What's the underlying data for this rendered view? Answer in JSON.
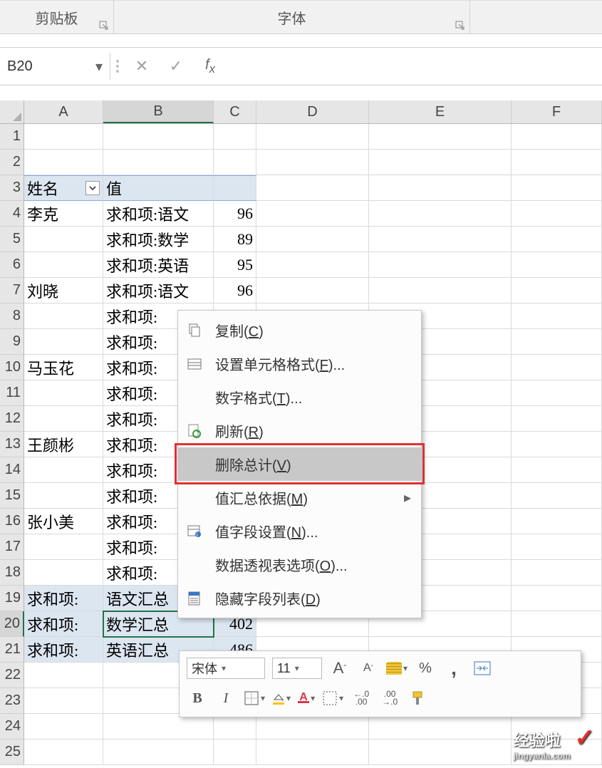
{
  "ribbon": {
    "group1": "剪贴板",
    "group2": "字体"
  },
  "namebox": "B20",
  "columns": [
    "A",
    "B",
    "C",
    "D",
    "E",
    "F"
  ],
  "row_numbers": [
    1,
    2,
    3,
    4,
    5,
    6,
    7,
    8,
    9,
    10,
    11,
    12,
    13,
    14,
    15,
    16,
    17,
    18,
    19,
    20,
    21,
    22,
    23,
    24,
    25
  ],
  "header": {
    "name": "姓名",
    "value": "值"
  },
  "pivot_rows": [
    {
      "r": 4,
      "a": "李克",
      "b": "求和项:语文",
      "c": "96"
    },
    {
      "r": 5,
      "a": "",
      "b": "求和项:数学",
      "c": "89"
    },
    {
      "r": 6,
      "a": "",
      "b": "求和项:英语",
      "c": "95"
    },
    {
      "r": 7,
      "a": "刘晓",
      "b": "求和项:语文",
      "c": "96"
    },
    {
      "r": 8,
      "a": "",
      "b": "求和项:",
      "c": ""
    },
    {
      "r": 9,
      "a": "",
      "b": "求和项:",
      "c": ""
    },
    {
      "r": 10,
      "a": "马玉花",
      "b": "求和项:",
      "c": ""
    },
    {
      "r": 11,
      "a": "",
      "b": "求和项:",
      "c": ""
    },
    {
      "r": 12,
      "a": "",
      "b": "求和项:",
      "c": ""
    },
    {
      "r": 13,
      "a": "王颜彬",
      "b": "求和项:",
      "c": ""
    },
    {
      "r": 14,
      "a": "",
      "b": "求和项:",
      "c": ""
    },
    {
      "r": 15,
      "a": "",
      "b": "求和项:",
      "c": ""
    },
    {
      "r": 16,
      "a": "张小美",
      "b": "求和项:",
      "c": ""
    },
    {
      "r": 17,
      "a": "",
      "b": "求和项:",
      "c": ""
    },
    {
      "r": 18,
      "a": "",
      "b": "求和项:",
      "c": ""
    }
  ],
  "totals": [
    {
      "r": 19,
      "a": "求和项:",
      "b": "语文汇总"
    },
    {
      "r": 20,
      "a": "求和项:",
      "b": "数学汇总",
      "c": "402"
    },
    {
      "r": 21,
      "a": "求和项:",
      "b": "英语汇总",
      "c": "486"
    }
  ],
  "context_menu": {
    "copy": "复制(",
    "copy_u": "C",
    "copy_e": ")",
    "format_cells": "设置单元格格式(",
    "format_cells_u": "F",
    "format_cells_e": ")...",
    "number_format": "数字格式(",
    "number_format_u": "T",
    "number_format_e": ")...",
    "refresh": "刷新(",
    "refresh_u": "R",
    "refresh_e": ")",
    "remove_total": "删除总计(",
    "remove_total_u": "V",
    "remove_total_e": ")",
    "summarize": "值汇总依据(",
    "summarize_u": "M",
    "summarize_e": ")",
    "field_settings": "值字段设置(",
    "field_settings_u": "N",
    "field_settings_e": ")...",
    "pt_options": "数据透视表选项(",
    "pt_options_u": "O",
    "pt_options_e": ")...",
    "hide_list": "隐藏字段列表(",
    "hide_list_u": "D",
    "hide_list_e": ")"
  },
  "mini_toolbar": {
    "font_name": "宋体",
    "font_size": "11",
    "grow": "A",
    "shrink": "A",
    "percent": "%",
    "comma": ",",
    "inc_dec": "←.0 .00",
    "dec_dec": ".00 →.0"
  },
  "watermark": {
    "main": "经验啦",
    "sub": "jingyanla.com"
  }
}
